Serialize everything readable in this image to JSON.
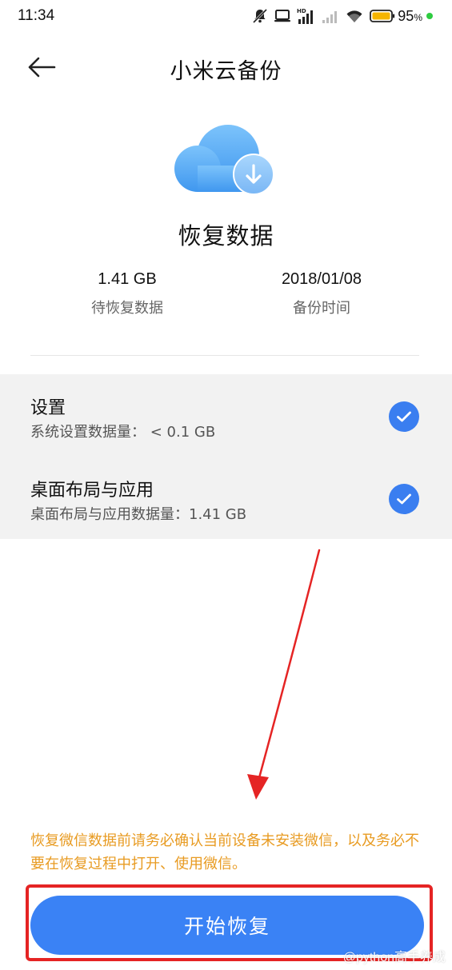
{
  "status_bar": {
    "time": "11:34",
    "battery_percent": "95",
    "battery_unit": "%",
    "signal_label": "HD",
    "icons": [
      "mute-bell-icon",
      "laptop-icon",
      "hd-signal-icon",
      "signal-bars-icon",
      "wifi-icon",
      "battery-icon"
    ]
  },
  "header": {
    "title": "小米云备份",
    "back_icon": "arrow-left-icon"
  },
  "hero": {
    "icon": "cloud-download-icon",
    "title": "恢复数据"
  },
  "stats": [
    {
      "value": "1.41 GB",
      "label": "待恢复数据"
    },
    {
      "value": "2018/01/08",
      "label": "备份时间"
    }
  ],
  "options": [
    {
      "title": "设置",
      "subtitle": "系统设置数据量： < 0.1 GB",
      "checked": true
    },
    {
      "title": "桌面布局与应用",
      "subtitle": "桌面布局与应用数据量：1.41 GB",
      "checked": true
    }
  ],
  "notice": "恢复微信数据前请务必确认当前设备未安装微信，以及务必不要在恢复过程中打开、使用微信。",
  "start_button": "开始恢复",
  "watermark": "@python高手养成",
  "colors": {
    "accent": "#3a82f5",
    "check": "#3a7ef0",
    "notice": "#e89b22",
    "annotation": "#e52424"
  }
}
